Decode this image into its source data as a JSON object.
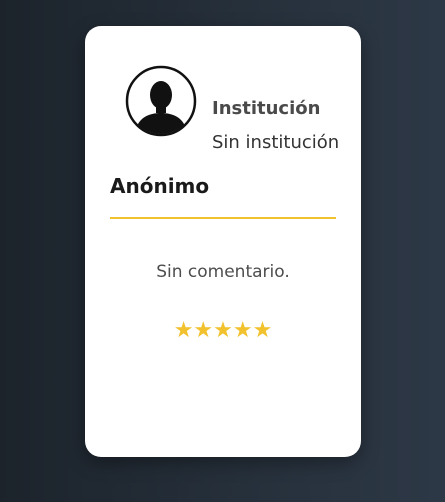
{
  "card": {
    "institution_label": "Institución",
    "institution_value": "Sin institución",
    "name": "Anónimo",
    "comment": "Sin comentario.",
    "stars_text": "★★★★★",
    "rating": 5,
    "rating_max": 5,
    "avatar_icon": "user-silhouette-icon"
  },
  "colors": {
    "accent": "#f2c12e",
    "card_bg": "#ffffff",
    "background_dark": "#1c232b"
  }
}
